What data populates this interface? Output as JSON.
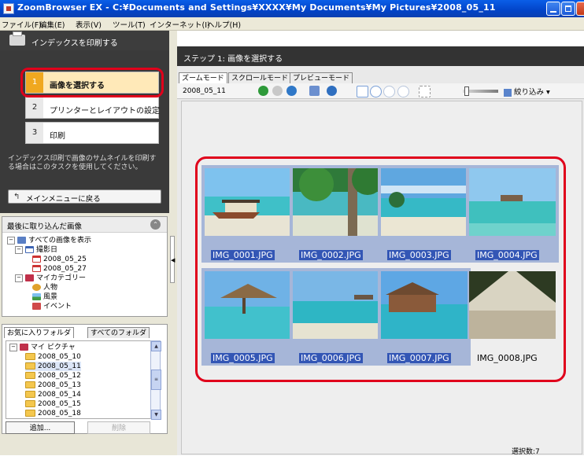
{
  "window": {
    "title": "ZoomBrowser EX - C:¥Documents and Settings¥XXXX¥My Documents¥My Pictures¥2008_05_11"
  },
  "menu": [
    "ファイル(F)",
    "編集(E)",
    "表示(V)",
    "ツール(T)",
    "インターネット(I)",
    "ヘルプ(H)"
  ],
  "task_panel": {
    "header": "インデックスを印刷する",
    "steps": [
      {
        "num": "1",
        "label": "画像を選択する"
      },
      {
        "num": "2",
        "label": "プリンターとレイアウトの設定"
      },
      {
        "num": "3",
        "label": "印刷"
      }
    ],
    "description": "インデックス印刷で画像のサムネイルを印刷する場合はこのタスクを使用してください。",
    "back_button": "メインメニューに戻る"
  },
  "recent_panel": {
    "header": "最後に取り込んだ画像",
    "tree": [
      {
        "label": "すべての画像を表示",
        "icon": "all-images-icon"
      },
      {
        "label": "撮影日",
        "icon": "calendar-icon"
      },
      {
        "label": "2008_05_25",
        "icon": "date-icon"
      },
      {
        "label": "2008_05_27",
        "icon": "date-icon"
      },
      {
        "label": "マイカテゴリー",
        "icon": "category-icon"
      },
      {
        "label": "人物",
        "icon": "person-icon"
      },
      {
        "label": "風景",
        "icon": "landscape-icon"
      },
      {
        "label": "イベント",
        "icon": "event-icon"
      }
    ]
  },
  "folder_panel": {
    "tabs": [
      "お気に入りフォルダ",
      "すべてのフォルダ"
    ],
    "root": "マイ ピクチャ",
    "folders": [
      "2008_05_10",
      "2008_05_11",
      "2008_05_12",
      "2008_05_13",
      "2008_05_14",
      "2008_05_15",
      "2008_05_18"
    ],
    "selected_folder": "2008_05_11",
    "add_button": "追加...",
    "delete_button": "削除"
  },
  "right_pane": {
    "step_title": "ステップ 1: 画像を選択する",
    "tabs": [
      "ズームモード",
      "スクロールモード",
      "プレビューモード"
    ],
    "active_tab": "ズームモード",
    "folder_label": "2008_05_11",
    "filter_button": "絞り込み"
  },
  "thumbnails": [
    {
      "filename": "IMG_0001.JPG",
      "selected": true,
      "scene": "boat"
    },
    {
      "filename": "IMG_0002.JPG",
      "selected": true,
      "scene": "palm"
    },
    {
      "filename": "IMG_0003.JPG",
      "selected": true,
      "scene": "beach"
    },
    {
      "filename": "IMG_0004.JPG",
      "selected": true,
      "scene": "lagoon"
    },
    {
      "filename": "IMG_0005.JPG",
      "selected": true,
      "scene": "hut"
    },
    {
      "filename": "IMG_0006.JPG",
      "selected": true,
      "scene": "sea"
    },
    {
      "filename": "IMG_0007.JPG",
      "selected": true,
      "scene": "villa"
    },
    {
      "filename": "IMG_0008.JPG",
      "selected": false,
      "scene": "sunset"
    }
  ],
  "status": {
    "text": "選択数:7"
  },
  "colors": {
    "titlebar": "#0a5ee8",
    "highlight": "#e0001b",
    "selection": "#3356b5"
  }
}
